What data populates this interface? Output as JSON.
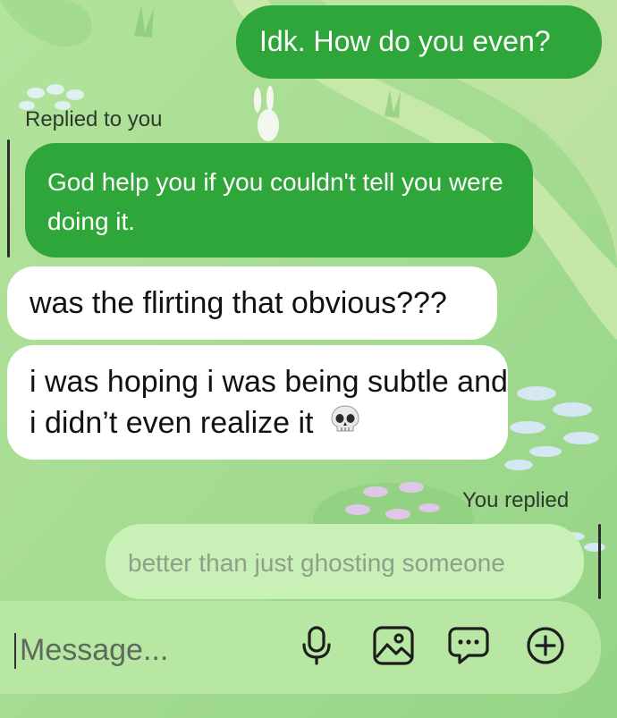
{
  "thread": {
    "messages": [
      {
        "direction": "outgoing",
        "text": "Idk. How do you even?"
      },
      {
        "direction": "outgoing",
        "reply_label": "Replied to you",
        "text": "God help you if you couldn't tell you were doing it."
      },
      {
        "direction": "incoming",
        "text": "was the flirting that obvious???"
      },
      {
        "direction": "incoming",
        "text": "i was hoping i was being subtle and i didn’t even realize it",
        "emoji": "skull"
      },
      {
        "direction": "outgoing",
        "reply_label": "You replied",
        "text": "better than just ghosting someone",
        "quoted": true
      }
    ]
  },
  "composer": {
    "placeholder": "Message...",
    "icons": [
      "microphone-icon",
      "image-icon",
      "sticker-chat-icon",
      "plus-circle-icon"
    ]
  },
  "colors": {
    "outgoing_bubble": "#2fa63a",
    "incoming_bubble": "#ffffff",
    "quoted_bubble": "#c9f0b6",
    "background": "#a6dc93"
  }
}
